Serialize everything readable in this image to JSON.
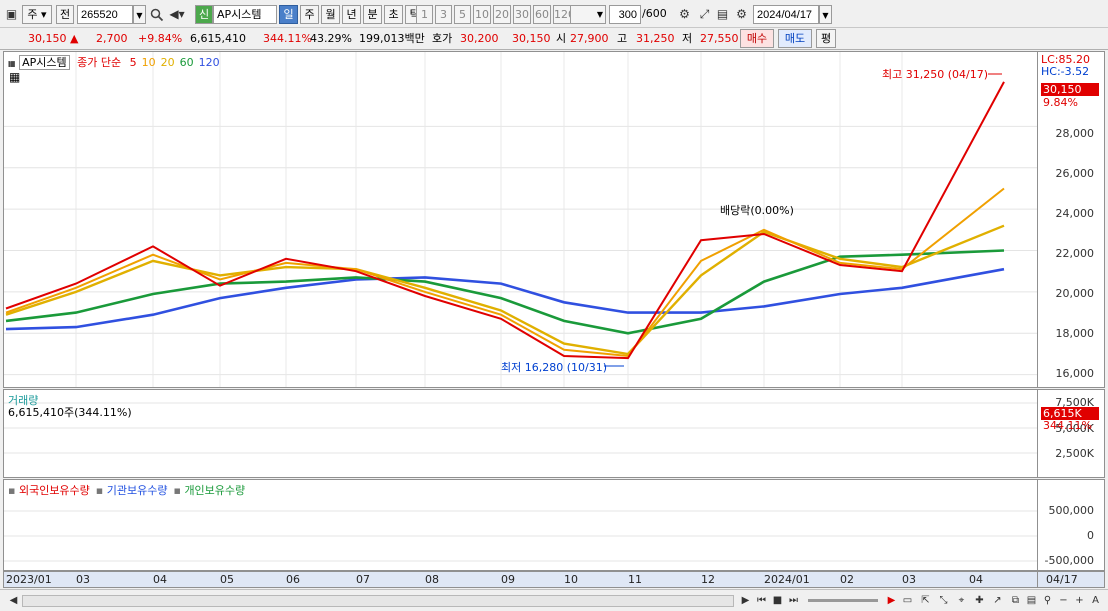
{
  "toolbar": {
    "mode_label": "주",
    "prefix_label": "전",
    "code_value": "265520",
    "new_badge": "신",
    "stock_name": "AP시스템",
    "periods": [
      "일",
      "주",
      "월",
      "년",
      "분",
      "초",
      "틱"
    ],
    "active_period": "일",
    "intervals": [
      "1",
      "3",
      "5",
      "10",
      "20",
      "30",
      "60",
      "120"
    ],
    "count_value": "300",
    "count_total": "/600",
    "date_value": "2024/04/17"
  },
  "quote": {
    "price": "30,150",
    "change": "2,700",
    "change_pct": "+9.84%",
    "volume": "6,615,410",
    "vol_ratio": "344.11%",
    "turnover": "43.29%",
    "amount": "199,013백만",
    "bid_label": "호가",
    "bid1": "30,200",
    "bid2": "30,150",
    "open_label": "시",
    "open": "27,900",
    "high_label": "고",
    "high": "31,250",
    "low_label": "저",
    "low": "27,550",
    "buy_btn": "매수",
    "sell_btn": "매도",
    "eval_btn": "평"
  },
  "price_pane": {
    "name": "AP시스템",
    "ma_label": "종가 단순",
    "ma_periods": [
      "5",
      "10",
      "20",
      "60",
      "120"
    ],
    "ma_colors": [
      "#e00000",
      "#f0a000",
      "#e0b000",
      "#1a9a3a",
      "#3050e0"
    ],
    "lc": "LC:85.20",
    "hc": "HC:-3.52",
    "last_price": "30,150",
    "last_pct": "9.84%",
    "high_note": "최고 31,250 (04/17)",
    "low_note": "최저 16,280 (10/31)",
    "event_note": "배당락(0.00%)",
    "y_ticks": [
      "28,000",
      "26,000",
      "24,000",
      "22,000",
      "20,000",
      "18,000",
      "16,000"
    ]
  },
  "volume_pane": {
    "title": "거래량",
    "value": "6,615,410주(344.11%)",
    "badge": "6,615K",
    "badge_pct": "344.11%",
    "y_ticks": [
      "7,500K",
      "5,000K",
      "2,500K"
    ]
  },
  "holding_pane": {
    "series": [
      {
        "name": "외국인보유수량",
        "color": "#e00000"
      },
      {
        "name": "기관보유수량",
        "color": "#2050e0"
      },
      {
        "name": "개인보유수량",
        "color": "#1a9a3a"
      }
    ],
    "y_ticks": [
      "500,000",
      "0",
      "-500,000"
    ]
  },
  "x_axis": [
    "2023/01",
    "03",
    "04",
    "05",
    "06",
    "07",
    "08",
    "09",
    "10",
    "11",
    "12",
    "2024/01",
    "02",
    "03",
    "04"
  ],
  "x_axis_right": "04/17",
  "chart_data": {
    "type": "line",
    "x": [
      "2023/01",
      "03",
      "04",
      "05",
      "06",
      "07",
      "08",
      "09",
      "10",
      "11",
      "12",
      "2024/01",
      "02",
      "03",
      "04"
    ],
    "ylim": [
      15500,
      31500
    ],
    "series": [
      {
        "name": "5",
        "values": [
          19200,
          20400,
          22200,
          20300,
          21600,
          21000,
          19800,
          18700,
          16900,
          16800,
          22500,
          22800,
          21300,
          21000,
          30150
        ]
      },
      {
        "name": "10",
        "values": [
          19000,
          20200,
          21800,
          20600,
          21400,
          21100,
          20000,
          18900,
          17200,
          16900,
          21500,
          23000,
          21400,
          21100,
          25000
        ]
      },
      {
        "name": "20",
        "values": [
          18900,
          20000,
          21500,
          20800,
          21200,
          21100,
          20200,
          19100,
          17500,
          17000,
          20800,
          22900,
          21600,
          21200,
          23200
        ]
      },
      {
        "name": "60",
        "values": [
          18600,
          19000,
          19900,
          20400,
          20500,
          20700,
          20500,
          19700,
          18600,
          18000,
          18700,
          20500,
          21700,
          21800,
          22000
        ]
      },
      {
        "name": "120",
        "values": [
          18200,
          18300,
          18900,
          19700,
          20200,
          20600,
          20700,
          20400,
          19500,
          19000,
          19000,
          19300,
          19900,
          20200,
          21100
        ]
      }
    ]
  }
}
